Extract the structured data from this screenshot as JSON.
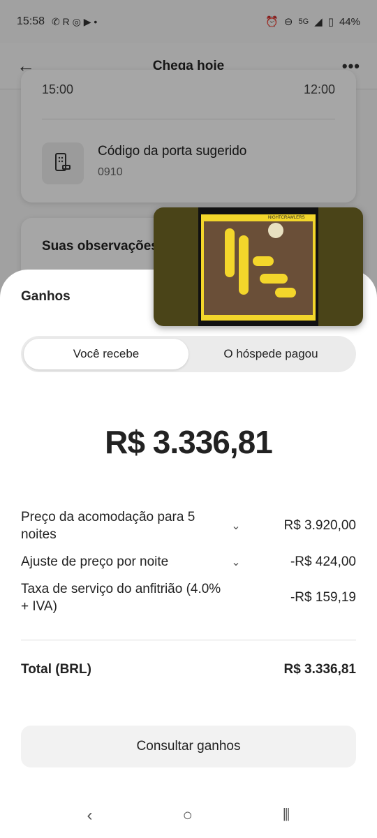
{
  "statusbar": {
    "time": "15:58",
    "network": "5G",
    "battery": "44%"
  },
  "topbar": {
    "title": "Chega hoje"
  },
  "background_card": {
    "checkin_time": "15:00",
    "checkout_time": "12:00",
    "door_code_label": "Código da porta sugerido",
    "door_code_value": "0910",
    "notes_title": "Suas observações"
  },
  "sheet": {
    "title": "Ganhos",
    "segments": [
      "Você recebe",
      "O hóspede pagou"
    ],
    "selected_segment": "Você recebe",
    "amount": "R$ 3.336,81",
    "rows": [
      {
        "label": "Preço da acomodação para 5 noites",
        "value": "R$ 3.920,00"
      },
      {
        "label": "Ajuste de preço por noite",
        "value": "-R$ 424,00"
      },
      {
        "label": "Taxa de serviço do anfitrião (4.0% + IVA)",
        "value": "-R$ 159,19"
      }
    ],
    "total_label": "Total (BRL)",
    "total_value": "R$ 3.336,81",
    "button_label": "Consultar ganhos"
  },
  "pip": {
    "album_text": "NIGHTCRAWLERS"
  }
}
